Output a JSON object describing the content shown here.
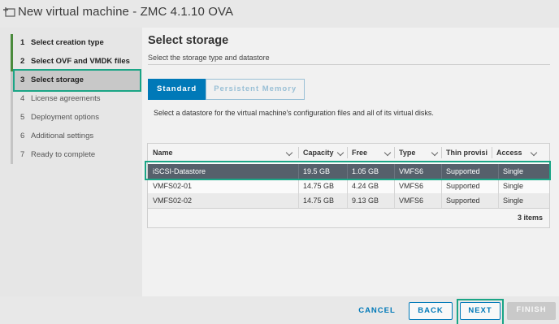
{
  "window": {
    "title": "New virtual machine - ZMC 4.1.10 OVA",
    "icon": "new-vm-icon"
  },
  "sidebar": {
    "steps": [
      {
        "number": "1",
        "label": "Select creation type",
        "state": "done"
      },
      {
        "number": "2",
        "label": "Select OVF and VMDK files",
        "state": "done"
      },
      {
        "number": "3",
        "label": "Select storage",
        "state": "active"
      },
      {
        "number": "4",
        "label": "License agreements",
        "state": "pending"
      },
      {
        "number": "5",
        "label": "Deployment options",
        "state": "pending"
      },
      {
        "number": "6",
        "label": "Additional settings",
        "state": "pending"
      },
      {
        "number": "7",
        "label": "Ready to complete",
        "state": "pending"
      }
    ]
  },
  "main": {
    "title": "Select storage",
    "subtitle": "Select the storage type and datastore",
    "tabs": [
      {
        "label": "Standard",
        "selected": true
      },
      {
        "label": "Persistent Memory",
        "selected": false
      }
    ],
    "info": "Select a datastore for the virtual machine's configuration files and all of its virtual disks."
  },
  "grid": {
    "columns": [
      "Name",
      "Capacity",
      "Free",
      "Type",
      "Thin provisi",
      "Access"
    ],
    "rows": [
      {
        "cells": [
          "iSCSI-Datastore",
          "19.5 GB",
          "1.05 GB",
          "VMFS6",
          "Supported",
          "Single"
        ],
        "selected": true
      },
      {
        "cells": [
          "VMFS02-01",
          "14.75 GB",
          "4.24 GB",
          "VMFS6",
          "Supported",
          "Single"
        ],
        "selected": false
      },
      {
        "cells": [
          "VMFS02-02",
          "14.75 GB",
          "9.13 GB",
          "VMFS6",
          "Supported",
          "Single"
        ],
        "selected": false
      }
    ],
    "footer": "3 items"
  },
  "footer": {
    "cancel": "CANCEL",
    "back": "BACK",
    "next": "NEXT",
    "finish": "FINISH"
  },
  "colors": {
    "accent": "#0079b8",
    "highlight": "#1aa586",
    "selected_row": "#56606b",
    "done_rail": "#4a8a3c"
  }
}
